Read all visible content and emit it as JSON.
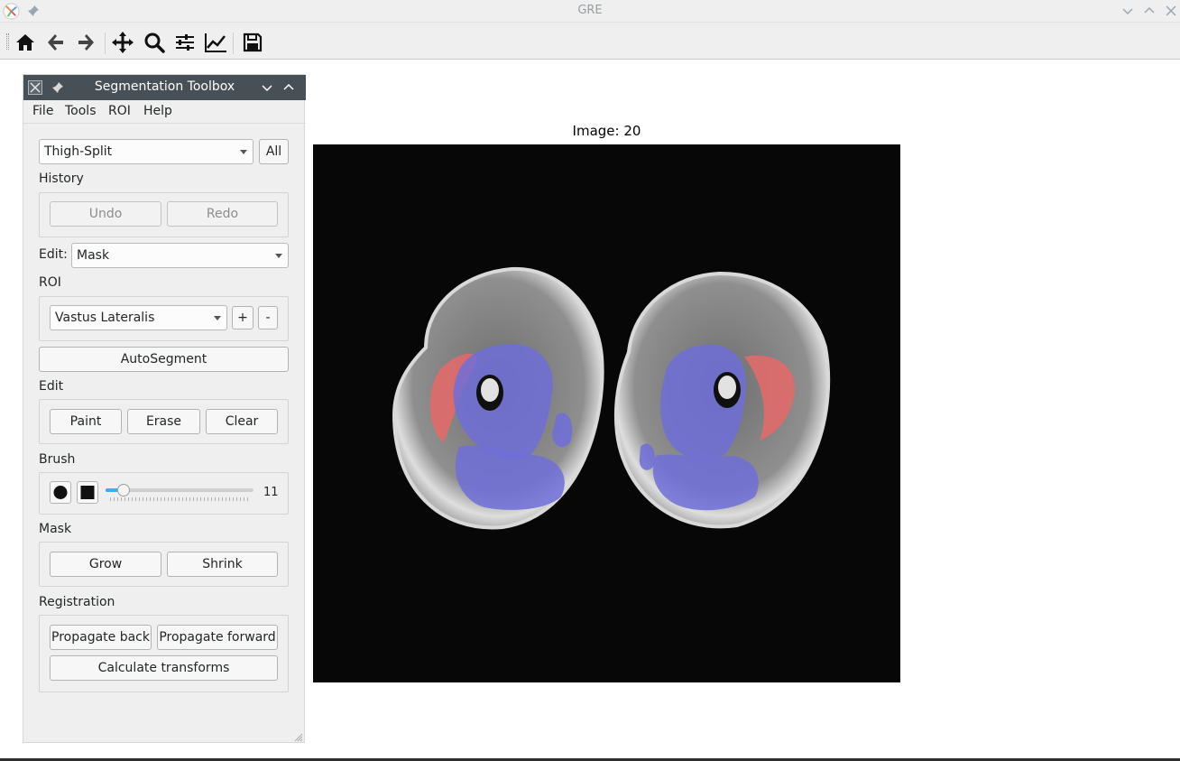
{
  "window": {
    "title": "GRE"
  },
  "toolbar": {
    "buttons": [
      "home-icon",
      "back-icon",
      "forward-icon",
      "pan-icon",
      "zoom-icon",
      "subplots-icon",
      "edit-axis-icon",
      "save-icon"
    ]
  },
  "dock": {
    "title": "Segmentation Toolbox",
    "menu": [
      "File",
      "Tools",
      "ROI",
      "Help"
    ]
  },
  "panel": {
    "class_select": "Thigh-Split",
    "all_button": "All",
    "history_label": "History",
    "undo": "Undo",
    "redo": "Redo",
    "edit_mode_label": "Edit:",
    "edit_mode_value": "Mask",
    "roi_label": "ROI",
    "roi_value": "Vastus Lateralis",
    "roi_add": "+",
    "roi_remove": "-",
    "autosegment": "AutoSegment",
    "edit_label": "Edit",
    "paint": "Paint",
    "erase": "Erase",
    "clear": "Clear",
    "brush_label": "Brush",
    "brush_size": "11",
    "mask_label": "Mask",
    "grow": "Grow",
    "shrink": "Shrink",
    "registration_label": "Registration",
    "propagate_back": "Propagate back",
    "propagate_forward": "Propagate forward",
    "calculate_transforms": "Calculate transforms"
  },
  "figure": {
    "title": "Image: 20"
  },
  "colors": {
    "accent": "#3daee9",
    "dock_header": "#475057",
    "roi_red": "#e06a6a",
    "roi_blue": "#6f6fd8"
  }
}
